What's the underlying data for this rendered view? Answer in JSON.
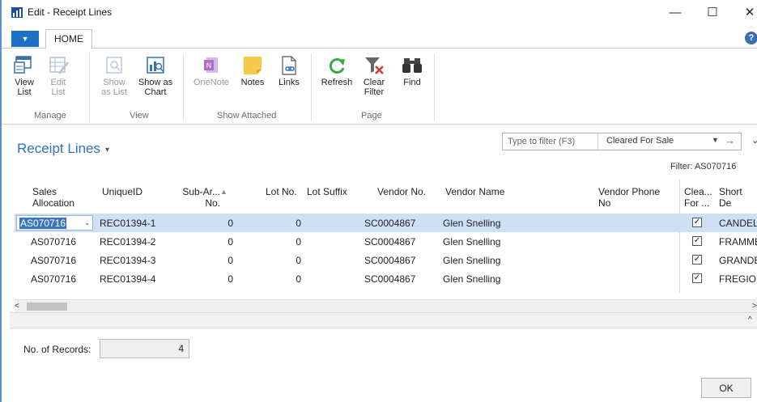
{
  "window": {
    "title": "Edit - Receipt Lines",
    "minimize_glyph": "—",
    "maximize_glyph": "☐",
    "close_glyph": "✕"
  },
  "ribbon": {
    "menu_glyph": "▼",
    "tab": "HOME",
    "help_glyph": "?",
    "groups": {
      "manage": "Manage",
      "view": "View",
      "show_attached": "Show Attached",
      "page": "Page"
    },
    "buttons": {
      "view_list": [
        "View",
        "List"
      ],
      "edit_list": [
        "Edit",
        "List"
      ],
      "show_as_list": [
        "Show",
        "as List"
      ],
      "show_as_chart": [
        "Show as",
        "Chart"
      ],
      "onenote": "OneNote",
      "notes": "Notes",
      "links": "Links",
      "refresh": "Refresh",
      "clear_filter": [
        "Clear",
        "Filter"
      ],
      "find": "Find"
    }
  },
  "page": {
    "title": "Receipt Lines",
    "title_caret": "▾",
    "filter_placeholder": "Type to filter (F3)",
    "filter_field": "Cleared For Sale",
    "filter_caret": "▼",
    "filter_go": "→",
    "collapse_glyph": "⌄",
    "filter_applied": "Filter: AS070716"
  },
  "grid": {
    "columns": {
      "sales_allocation": [
        "Sales",
        "Allocation"
      ],
      "unique_id": "UniqueID",
      "sub_area": [
        "Sub-Ar...",
        "No."
      ],
      "sort_glyph": "▲",
      "lot_no": "Lot No.",
      "lot_suffix": "Lot Suffix",
      "vendor_no": "Vendor No.",
      "vendor_name": "Vendor Name",
      "vendor_phone": [
        "Vendor Phone",
        "No"
      ],
      "cleared": [
        "Clea...",
        "For ..."
      ],
      "short_desc": "Short De"
    },
    "rows": [
      {
        "sales_allocation": "AS070716",
        "unique_id": "REC01394-1",
        "sub_area": "0",
        "lot_no": "0",
        "vendor_no": "SC0004867",
        "vendor_name": "Glen Snelling",
        "short_desc": "CANDELI"
      },
      {
        "sales_allocation": "AS070716",
        "unique_id": "REC01394-2",
        "sub_area": "0",
        "lot_no": "0",
        "vendor_no": "SC0004867",
        "vendor_name": "Glen Snelling",
        "short_desc": "FRAMME"
      },
      {
        "sales_allocation": "AS070716",
        "unique_id": "REC01394-3",
        "sub_area": "0",
        "lot_no": "0",
        "vendor_no": "SC0004867",
        "vendor_name": "Glen Snelling",
        "short_desc": "GRANDE"
      },
      {
        "sales_allocation": "AS070716",
        "unique_id": "REC01394-4",
        "sub_area": "0",
        "lot_no": "0",
        "vendor_no": "SC0004867",
        "vendor_name": "Glen Snelling",
        "short_desc": "FREGIO I"
      }
    ],
    "check_glyph": "✓",
    "dropdown_glyph": "⌄"
  },
  "scroll": {
    "left_glyph": "<",
    "right_glyph": ">",
    "up_glyph": "^"
  },
  "footer": {
    "records_label": "No. of Records:",
    "records_value": "4",
    "ok_label": "OK"
  }
}
